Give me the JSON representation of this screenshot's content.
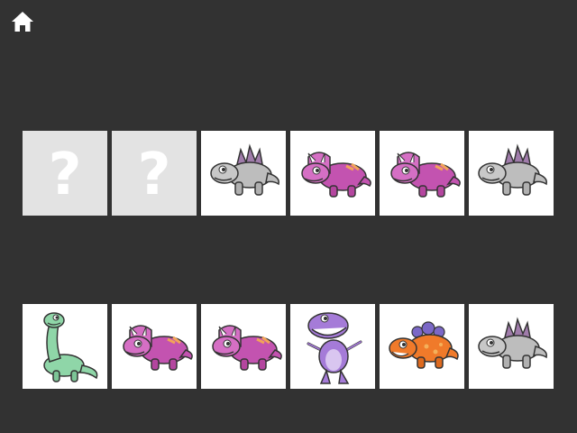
{
  "toolbar": {
    "home_icon": "home-icon"
  },
  "board": {
    "top_row": [
      {
        "state": "hidden",
        "symbol": "?"
      },
      {
        "state": "hidden",
        "symbol": "?"
      },
      {
        "state": "revealed",
        "dino": "grey-stegosaurus"
      },
      {
        "state": "revealed",
        "dino": "pink-triceratops"
      },
      {
        "state": "revealed",
        "dino": "pink-triceratops"
      },
      {
        "state": "revealed",
        "dino": "grey-stegosaurus"
      }
    ],
    "bottom_row": [
      {
        "state": "revealed",
        "dino": "green-brachiosaurus"
      },
      {
        "state": "revealed",
        "dino": "pink-triceratops"
      },
      {
        "state": "revealed",
        "dino": "pink-triceratops"
      },
      {
        "state": "revealed",
        "dino": "purple-trex"
      },
      {
        "state": "revealed",
        "dino": "orange-stegosaurus"
      },
      {
        "state": "revealed",
        "dino": "grey-stegosaurus"
      }
    ]
  },
  "colors": {
    "background": "#323232",
    "hidden_card": "#e3e3e3",
    "card": "#ffffff"
  }
}
